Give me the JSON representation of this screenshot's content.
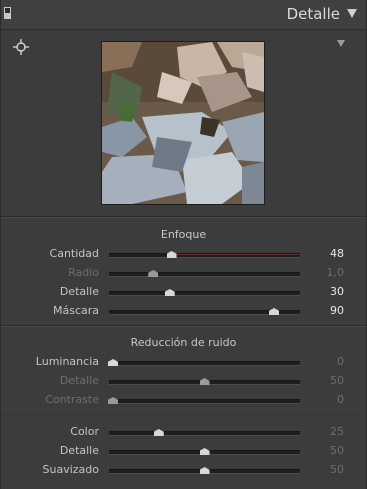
{
  "panel": {
    "title": "Detalle"
  },
  "sharpening": {
    "title": "Enfoque",
    "rows": [
      {
        "label": "Cantidad",
        "value": "48",
        "level": 0.32,
        "dim": false
      },
      {
        "label": "Radio",
        "value": "1,0",
        "level": 0.22,
        "dim": true
      },
      {
        "label": "Detalle",
        "value": "30",
        "level": 0.31,
        "dim": false
      },
      {
        "label": "Máscara",
        "value": "90",
        "level": 0.88,
        "dim": false
      }
    ]
  },
  "noise": {
    "title": "Reducción de ruido",
    "rows": [
      {
        "label": "Luminancia",
        "value": "0",
        "level": 0.0,
        "dim": false,
        "valDim": true
      },
      {
        "label": "Detalle",
        "value": "50",
        "level": 0.5,
        "dim": true,
        "valDim": true
      },
      {
        "label": "Contraste",
        "value": "0",
        "level": 0.0,
        "dim": true,
        "valDim": true
      },
      {
        "label": "Color",
        "value": "25",
        "level": 0.25,
        "dim": false,
        "valDim": true
      },
      {
        "label": "Detalle",
        "value": "50",
        "level": 0.5,
        "dim": false,
        "valDim": true
      },
      {
        "label": "Suavizado",
        "value": "50",
        "level": 0.5,
        "dim": false,
        "valDim": true
      }
    ]
  },
  "icons": {
    "toggle": "panel-switch-icon",
    "collapse": "collapse-triangle-icon",
    "target": "target-adjustment-icon",
    "preview_menu": "preview-menu-triangle-icon"
  },
  "colors": {
    "panel_bg": "#3c3c3c",
    "track": "#1e1e1e",
    "thumb": "#d8d8d8",
    "amount_track_tint": "#6a2e2e"
  }
}
